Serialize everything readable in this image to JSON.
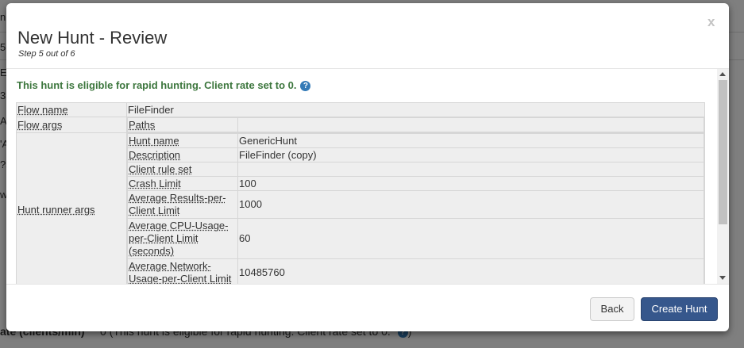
{
  "background": {
    "partial_texts": [
      "n",
      "5",
      "E",
      "3(",
      "A",
      "'A",
      "?s",
      "w"
    ],
    "bottom_label": "ate (clients/min)",
    "bottom_value": "0 (This hunt is eligible for rapid hunting. Client rate set to 0.",
    "bottom_suffix": ")"
  },
  "modal": {
    "title": "New Hunt - Review",
    "subtitle": "Step 5 out of 6",
    "close_label": "x",
    "eligible_message": "This hunt is eligible for rapid hunting. Client rate set to 0.",
    "help_icon": "?",
    "review": {
      "flow_name_label": "Flow name",
      "flow_name_value": "FileFinder",
      "flow_args_label": "Flow args",
      "paths_label": "Paths",
      "paths_value": "",
      "hunt_runner_label": "Hunt runner args",
      "runner_args": [
        {
          "label": "Hunt name",
          "value": "GenericHunt"
        },
        {
          "label": "Description",
          "value": "FileFinder (copy)"
        },
        {
          "label": "Client rule set",
          "value": ""
        },
        {
          "label": "Crash Limit",
          "value": "100"
        },
        {
          "label": "Average Results-per-Client Limit",
          "value": "1000"
        },
        {
          "label": "Average CPU-Usage-per-Client Limit (seconds)",
          "value": "60"
        },
        {
          "label": "Average Network-Usage-per-Client Limit",
          "value": "10485760"
        }
      ]
    },
    "buttons": {
      "back": "Back",
      "create": "Create Hunt"
    }
  },
  "colors": {
    "success_text": "#3c763d",
    "primary_button": "#36578c",
    "help_icon": "#337ab7"
  }
}
